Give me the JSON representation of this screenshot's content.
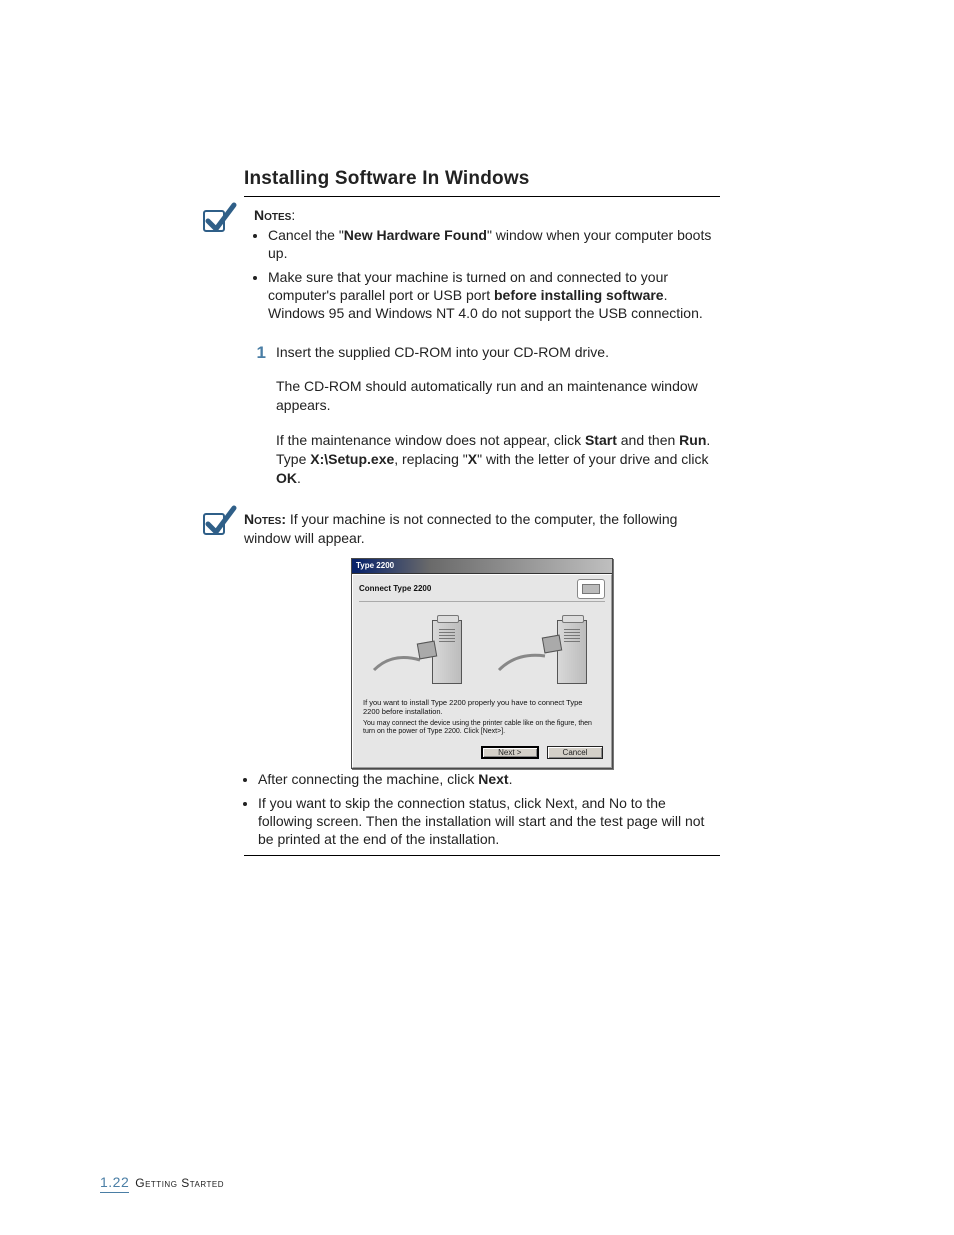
{
  "heading": "Installing  Software In Windows",
  "notes1": {
    "label": "Notes",
    "items": [
      {
        "pre": "Cancel the \"",
        "bold": "New Hardware Found",
        "post": "\" window when your computer boots up."
      },
      {
        "text_a": "Make sure that your machine is turned on and connected to your computer's parallel port or USB port ",
        "bold": "before installing software",
        "text_b": ". Windows 95 and Windows NT 4.0 do not support the USB connection."
      }
    ]
  },
  "step": {
    "num": "1",
    "p1": "Insert the supplied CD-ROM into your CD-ROM drive.",
    "p2": "The CD-ROM should automatically run and an maintenance window appears.",
    "p3_a": "If the maintenance window does not appear, click ",
    "p3_start": "Start",
    "p3_b": " and then ",
    "p3_run": "Run",
    "p3_c": ". Type ",
    "p3_cmd": "X:\\Setup.exe",
    "p3_d": ", replacing \"",
    "p3_x": "X",
    "p3_e": "\" with the letter of your drive and click ",
    "p3_ok": "OK",
    "p3_f": "."
  },
  "notes2": {
    "label": "Notes:",
    "text": " If your machine is not connected to the computer, the following window will appear."
  },
  "dialog": {
    "title": "Type 2200",
    "header": "Connect Type 2200",
    "msg1": "If you want to install Type 2200 properly you have to connect Type 2200 before installation.",
    "msg2": "You may connect the device using the printer cable like on the figure, then turn on the power of Type 2200.\nClick [Next>].",
    "btn_next": "Next >",
    "btn_cancel": "Cancel"
  },
  "after": {
    "items": [
      {
        "pre": "After connecting the machine, click ",
        "bold": "Next",
        "post": "."
      },
      {
        "text": "If you want to skip the connection status, click Next, and No to the following screen. Then the installation will start and the test page will not be printed at the end of the installation."
      }
    ]
  },
  "footer": {
    "page": "1.22",
    "section": "Getting Started"
  }
}
